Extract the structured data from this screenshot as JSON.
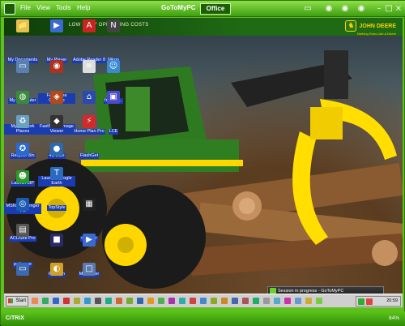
{
  "menu": {
    "file": "File",
    "view": "View",
    "tools": "Tools",
    "help": "Help"
  },
  "header": {
    "brand": "GoToMyPC",
    "computer": "Office"
  },
  "banner": {
    "slogan": "LOW DAILY OPERATING COSTS",
    "brand": "JOHN DEERE",
    "tagline": "Nothing Runs Like A Deere"
  },
  "icons": [
    {
      "id": "my-documents",
      "label": "My Documents",
      "glyph": "📁",
      "color": "#e6c14a"
    },
    {
      "id": "my-player",
      "label": "My Player",
      "glyph": "▶",
      "color": "#3a6ad0"
    },
    {
      "id": "adobe-reader",
      "label": "Adobe Reader 8",
      "glyph": "A",
      "color": "#c22"
    },
    {
      "id": "nikon",
      "label": "Nikon",
      "glyph": "N",
      "color": "#444"
    },
    {
      "id": "my-computer",
      "label": "My Computer",
      "glyph": "▭",
      "color": "#5a7fb0"
    },
    {
      "id": "faststone-capture",
      "label": "FastStone Capture",
      "glyph": "◉",
      "color": "#b0321e"
    },
    {
      "id": "txt-file",
      "label": ".txt",
      "glyph": "≡",
      "color": "#ddd"
    },
    {
      "id": "friendly",
      "label": "friendly...",
      "glyph": "☺",
      "color": "#3a8ad0"
    },
    {
      "id": "my-network-places",
      "label": "My Network Places",
      "glyph": "◍",
      "color": "#3a8a3a"
    },
    {
      "id": "faststone-image-viewer",
      "label": "FastStone Image Viewer",
      "glyph": "◈",
      "color": "#b04a1e"
    },
    {
      "id": "home-plan-pro",
      "label": "Home Plan Pro",
      "glyph": "⌂",
      "color": "#2a4ab0"
    },
    {
      "id": "lce",
      "label": "LCE",
      "glyph": "▣",
      "color": "#4a4ad0"
    },
    {
      "id": "recycle-bin",
      "label": "Recycle Bin",
      "glyph": "♻",
      "color": "#6aa0c0"
    },
    {
      "id": "elite",
      "label": "4C Elite",
      "glyph": "◆",
      "color": "#333"
    },
    {
      "id": "flashget",
      "label": "FlashGet",
      "glyph": "⚡",
      "color": "#d02a2a"
    },
    {
      "id": "launch-3ip",
      "label": "Launch 3IP",
      "glyph": "✪",
      "color": "#2a6ad0"
    },
    {
      "id": "launch-google-earth",
      "label": "Launch Google Earth",
      "glyph": "●",
      "color": "#2a6ab0"
    },
    {
      "id": "msn-messenger",
      "label": "MSN Messenger 7.0",
      "glyph": "☻",
      "color": "#2a9a2a"
    },
    {
      "id": "topstyle",
      "label": "TopStyle",
      "glyph": "T",
      "color": "#2a6ac0"
    },
    {
      "id": "acdsee-pro",
      "label": "ACDSee Pro",
      "glyph": "◎",
      "color": "#1a5ab0"
    },
    {
      "id": "mplayer",
      "label": "mplayer",
      "glyph": "▦",
      "color": "#222"
    },
    {
      "id": "putty",
      "label": "putty.exe",
      "glyph": "▤",
      "color": "#555"
    },
    {
      "id": "fazsan",
      "label": "FAZSan",
      "glyph": "■",
      "color": "#2a2a6a"
    },
    {
      "id": "my-player-2",
      "label": "My Player",
      "glyph": "▶",
      "color": "#3a6ad0"
    },
    {
      "id": "remote-desktop",
      "label": "Remote Desktop",
      "glyph": "▭",
      "color": "#3a6ab0"
    },
    {
      "id": "symantec-pcanywhere",
      "label": "Symantec pcAnywhere",
      "glyph": "◐",
      "color": "#d0a02a"
    },
    {
      "id": "unknown-shortcut",
      "label": "...",
      "glyph": "□",
      "color": "#5a7ab0"
    }
  ],
  "session": {
    "title": "Session in progress - GoToMyPC"
  },
  "taskbar": {
    "start": "Start",
    "clock": "20:59"
  },
  "statusbar": {
    "brand": "CiTRiX",
    "zoom": "84%"
  },
  "colors": {
    "accent": "#5fbf1c",
    "deere_green": "#367c2b",
    "deere_yellow": "#ffde00"
  }
}
